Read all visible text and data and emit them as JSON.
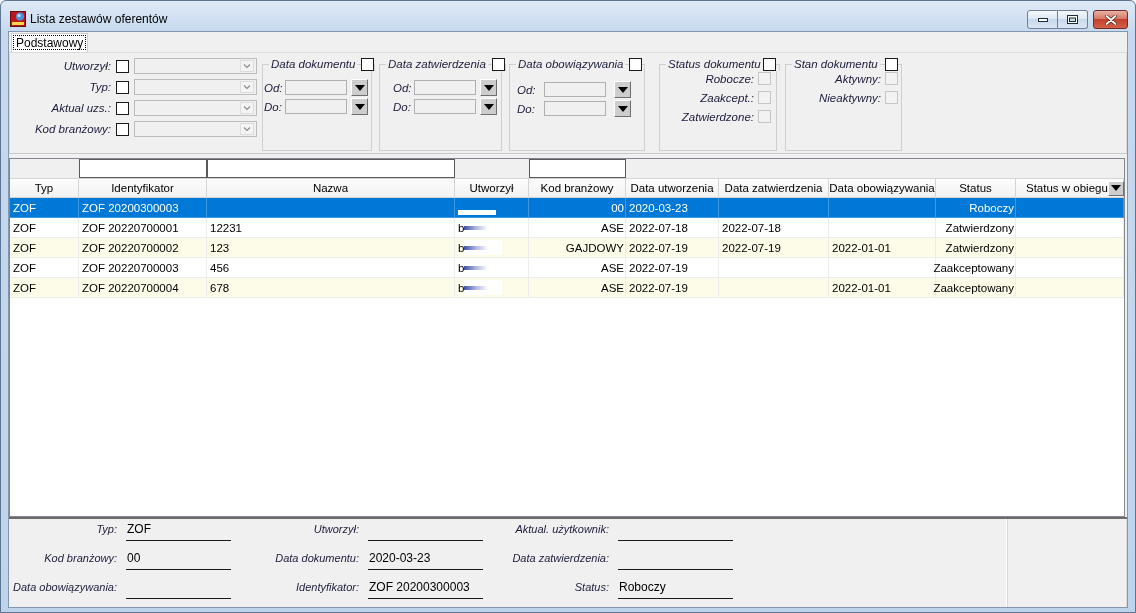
{
  "window": {
    "title": "Lista zestawów oferentów"
  },
  "tabs": [
    {
      "label": "Podstawowy",
      "selected": true
    }
  ],
  "filters": {
    "fields": [
      {
        "label": "Utworzył:",
        "checked": false
      },
      {
        "label": "Typ:",
        "checked": false
      },
      {
        "label": "Aktual uzs.:",
        "checked": false
      },
      {
        "label": "Kod branżowy:",
        "checked": false
      }
    ],
    "groups": [
      {
        "kind": "date_range",
        "title": "Data dokumentu",
        "checked": false,
        "rows": [
          {
            "label": "Od:"
          },
          {
            "label": "Do:"
          }
        ]
      },
      {
        "kind": "date_range",
        "title": "Data zatwierdzenia",
        "checked": false,
        "rows": [
          {
            "label": "Od:"
          },
          {
            "label": "Do:"
          }
        ]
      },
      {
        "kind": "date_range",
        "title": "Data obowiązywania",
        "checked": false,
        "rows": [
          {
            "label": "Od:"
          },
          {
            "label": "Do:"
          }
        ]
      },
      {
        "kind": "checklist",
        "title": "Status dokumentu",
        "checked": false,
        "rows": [
          {
            "label": "Robocze:",
            "checked": false,
            "disabled": true
          },
          {
            "label": "Zaakcept.:",
            "checked": false,
            "disabled": true
          },
          {
            "label": "Zatwierdzone:",
            "checked": false,
            "disabled": true
          }
        ]
      },
      {
        "kind": "checklist",
        "title": "Stan dokumentu",
        "checked": false,
        "rows": [
          {
            "label": "Aktywny:",
            "checked": false,
            "disabled": true
          },
          {
            "label": "Nieaktywny:",
            "checked": false,
            "disabled": true
          }
        ]
      }
    ]
  },
  "table": {
    "columns": [
      {
        "label": "Typ",
        "filter": false,
        "menu": false
      },
      {
        "label": "Identyfikator",
        "filter": true,
        "menu": false
      },
      {
        "label": "Nazwa",
        "filter": true,
        "menu": false
      },
      {
        "label": "Utworzył",
        "filter": false,
        "menu": false
      },
      {
        "label": "Kod branżowy",
        "filter": true,
        "menu": false
      },
      {
        "label": "Data utworzenia",
        "filter": false,
        "menu": false
      },
      {
        "label": "Data zatwierdzenia",
        "filter": false,
        "menu": false
      },
      {
        "label": "Data obowiązywania",
        "filter": false,
        "menu": false
      },
      {
        "label": "Status",
        "filter": false,
        "menu": false
      },
      {
        "label": "Status w obiegu",
        "filter": false,
        "menu": true
      }
    ],
    "rows": [
      {
        "selected": true,
        "redacted": true,
        "typ": "ZOF",
        "identyfikator": "ZOF 20200300003",
        "kod_branzowy": "00",
        "data_utworzenia": "2020-03-23",
        "status": "Roboczy"
      },
      {
        "selected": false,
        "redacted": true,
        "typ": "ZOF",
        "identyfikator": "ZOF 20220700001",
        "nazwa": "12231",
        "utworzyl": "b",
        "kod_branzowy": "ASE",
        "data_utworzenia": "2022-07-18",
        "data_zatwierdzenia": "2022-07-18",
        "status": "Zatwierdzony"
      },
      {
        "selected": false,
        "redacted": true,
        "typ": "ZOF",
        "identyfikator": "ZOF 20220700002",
        "nazwa": "123",
        "utworzyl": "b",
        "kod_branzowy": "GAJDOWY",
        "data_utworzenia": "2022-07-19",
        "data_zatwierdzenia": "2022-07-19",
        "data_obowiazywania": "2022-01-01",
        "status": "Zatwierdzony"
      },
      {
        "selected": false,
        "redacted": true,
        "typ": "ZOF",
        "identyfikator": "ZOF 20220700003",
        "nazwa": "456",
        "utworzyl": "b",
        "kod_branzowy": "ASE",
        "data_utworzenia": "2022-07-19",
        "status": "Zaakceptowany"
      },
      {
        "selected": false,
        "redacted": true,
        "typ": "ZOF",
        "identyfikator": "ZOF 20220700004",
        "nazwa": "678",
        "utworzyl": "b",
        "kod_branzowy": "ASE",
        "data_utworzenia": "2022-07-19",
        "data_obowiazywania": "2022-01-01",
        "status": "Zaakceptowany"
      }
    ]
  },
  "details": [
    {
      "label": "Typ:",
      "value": "ZOF"
    },
    {
      "label": "Utworzył:"
    },
    {
      "label": "Aktual. użytkownik:"
    },
    {
      "label": "Kod branżowy:",
      "value": "00"
    },
    {
      "label": "Data dokumentu:",
      "value": "2020-03-23"
    },
    {
      "label": "Data zatwierdzenia:"
    },
    {
      "label": "Data obowiązywania:"
    },
    {
      "label": "Identyfikator:",
      "value": "ZOF 20200300003"
    },
    {
      "label": "Status:",
      "value": "Roboczy"
    }
  ]
}
